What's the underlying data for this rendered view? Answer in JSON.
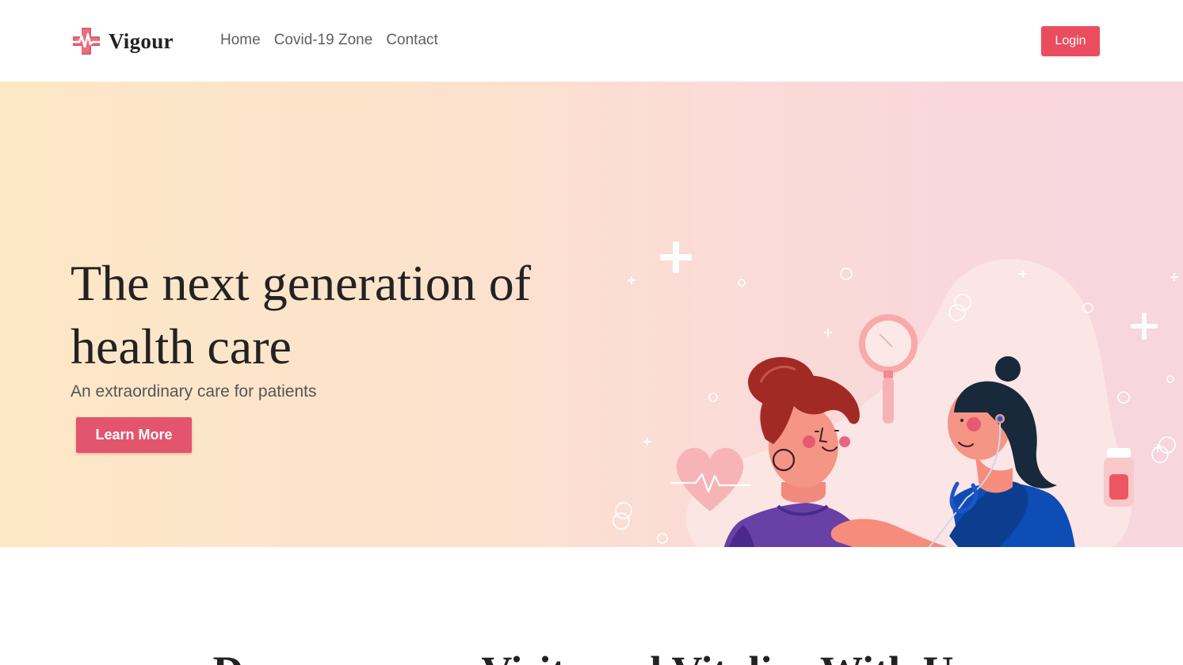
{
  "brand": {
    "name": "Vigour",
    "logo_icon": "medical-cross-pulse-icon"
  },
  "nav": {
    "items": [
      {
        "label": "Home"
      },
      {
        "label": "Covid-19 Zone"
      },
      {
        "label": "Contact"
      }
    ]
  },
  "header": {
    "login_label": "Login"
  },
  "hero": {
    "title": "The next generation of health care",
    "subtitle": "An extraordinary care for patients",
    "cta_label": "Learn More"
  },
  "next_section": {
    "heading": "Decrease your Visits and Vitalize With Us"
  },
  "colors": {
    "accent": "#ea4e5e",
    "cta": "#e3546d",
    "hero_gradient_start": "#fde8c6",
    "hero_gradient_end": "#f8d6df",
    "text_dark": "#222222",
    "text_muted": "#5f5f5f"
  }
}
